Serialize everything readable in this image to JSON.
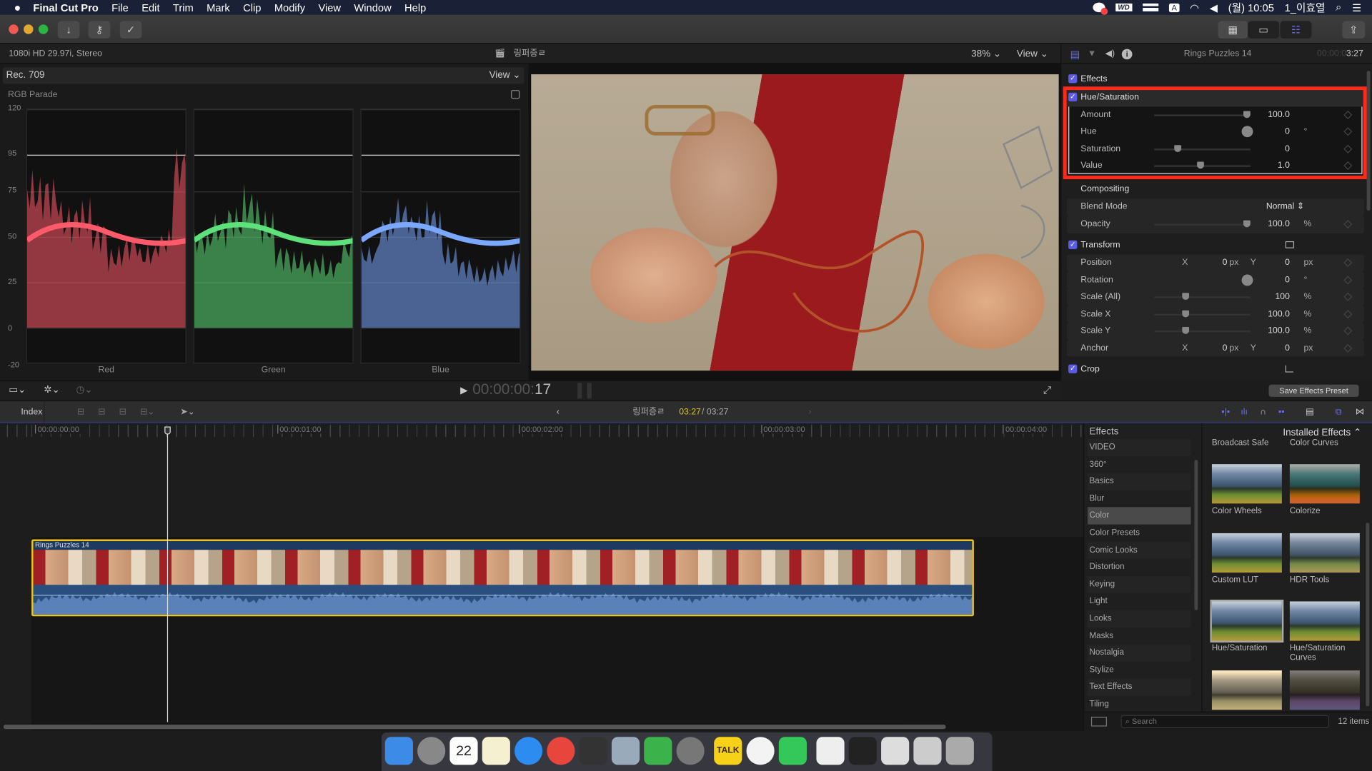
{
  "menubar": {
    "apple": "",
    "app": "Final Cut Pro",
    "items": [
      "File",
      "Edit",
      "Trim",
      "Mark",
      "Clip",
      "Modify",
      "View",
      "Window",
      "Help"
    ],
    "status": {
      "icons": [
        "notification-icon",
        "wd-drive-icon",
        "keyboard-icon",
        "input-source-icon",
        "wifi-icon",
        "volume-icon"
      ],
      "input_source": "A",
      "wd": "WD",
      "clock": "(월) 10:05",
      "user": "1_이효열"
    }
  },
  "toolbar": {
    "buttons": [
      "import-icon",
      "keywords-icon",
      "background-tasks-icon"
    ],
    "right": [
      "browser-toggle",
      "timeline-toggle",
      "inspector-toggle",
      "share-icon"
    ]
  },
  "viewer": {
    "format": "1080i HD 29.97i, Stereo",
    "project": "링퍼증ㄹ",
    "zoom": "38%",
    "view_label": "View",
    "timecode_dim": "00:00:00:",
    "timecode_frame": "17"
  },
  "scopes": {
    "colorspace": "Rec. 709",
    "view_label": "View",
    "title": "RGB Parade",
    "y_labels": [
      "120",
      "95",
      "75",
      "50",
      "25",
      "0",
      "-20"
    ],
    "channels": [
      "Red",
      "Green",
      "Blue"
    ],
    "colors": {
      "red": "#ff5a6a",
      "green": "#5ee07a",
      "blue": "#7aa8ff"
    }
  },
  "inspector": {
    "clip_name": "Rings Puzzles 14",
    "duration_dim": "00:00:0",
    "duration": "3:27",
    "effects_label": "Effects",
    "hue_sat": {
      "title": "Hue/Saturation",
      "params": [
        {
          "label": "Amount",
          "value": "100.0",
          "unit": "",
          "level": 1.0
        },
        {
          "label": "Hue",
          "value": "0",
          "unit": "°"
        },
        {
          "label": "Saturation",
          "value": "0",
          "unit": "",
          "level": 0.25
        },
        {
          "label": "Value",
          "value": "1.0",
          "unit": "",
          "level": 0.5
        }
      ]
    },
    "compositing": {
      "title": "Compositing",
      "blend_label": "Blend Mode",
      "blend_value": "Normal",
      "opacity_label": "Opacity",
      "opacity_value": "100.0",
      "opacity_unit": "%"
    },
    "transform": {
      "title": "Transform",
      "rows": [
        {
          "label": "Position",
          "x": "0",
          "y": "0",
          "unit": "px"
        },
        {
          "label": "Rotation",
          "value": "0",
          "unit": "°"
        },
        {
          "label": "Scale (All)",
          "value": "100",
          "unit": "%"
        },
        {
          "label": "Scale X",
          "value": "100.0",
          "unit": "%"
        },
        {
          "label": "Scale Y",
          "value": "100.0",
          "unit": "%"
        },
        {
          "label": "Anchor",
          "x": "0",
          "y": "0",
          "unit": "px"
        }
      ],
      "x_label": "X",
      "y_label": "Y"
    },
    "crop_label": "Crop",
    "save_preset": "Save Effects Preset",
    "highlight_color": "#ff2a1a",
    "accent": "#5b5ce6"
  },
  "timeline": {
    "index": "Index",
    "project": "링퍼증ㄹ",
    "position": "03:27",
    "total": "/ 03:27",
    "ruler": [
      "00:00:00:00",
      "00:00:01:00",
      "00:00:02:00",
      "00:00:03:00",
      "00:00:04:00"
    ],
    "clip_name": "Rings Puzzles 14",
    "clip_border": "#f0c419"
  },
  "effects_browser": {
    "title": "Effects",
    "source": "Installed Effects",
    "categories": [
      "VIDEO",
      "360°",
      "Basics",
      "Blur",
      "Color",
      "Color Presets",
      "Comic Looks",
      "Distortion",
      "Keying",
      "Light",
      "Looks",
      "Masks",
      "Nostalgia",
      "Stylize",
      "Text Effects",
      "Tiling"
    ],
    "selected": "Color",
    "items": [
      "Broadcast Safe",
      "Color Curves",
      "Color Wheels",
      "Colorize",
      "Custom LUT",
      "HDR Tools",
      "Hue/Saturation",
      "Hue/Saturation Curves",
      "",
      ""
    ],
    "search_placeholder": "Search",
    "count": "12 items"
  },
  "dock": {
    "apps": [
      "finder",
      "launchpad",
      "calendar",
      "notes",
      "safari",
      "chrome",
      "final-cut-pro",
      "preview",
      "cloud-app",
      "system-preferences",
      "kakaotalk",
      "itunes",
      "facetime",
      "doc1",
      "doc2",
      "doc3",
      "doc4",
      "trash"
    ],
    "calendar_day": "22",
    "kakao": "TALK"
  }
}
